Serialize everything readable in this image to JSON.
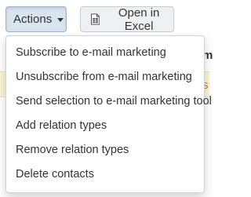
{
  "toolbar": {
    "actions_label": "Actions",
    "excel_label": "Open in Excel"
  },
  "background": {
    "column_fragment": "m",
    "row_fragment": "s"
  },
  "dropdown": {
    "items": [
      {
        "label": "Subscribe to e-mail marketing"
      },
      {
        "label": "Unsubscribe from e-mail marketing"
      },
      {
        "label": "Send selection to e-mail marketing tool"
      },
      {
        "label": "Add relation types"
      },
      {
        "label": "Remove relation types"
      },
      {
        "label": "Delete contacts"
      }
    ]
  },
  "colors": {
    "actions_active_bg": "#d9e4ee",
    "button_bg": "#eef1f4",
    "highlight_row_bg": "#fcf6d6"
  },
  "icons": {
    "actions_caret": "caret-down-icon",
    "excel": "spreadsheet-file-icon"
  }
}
